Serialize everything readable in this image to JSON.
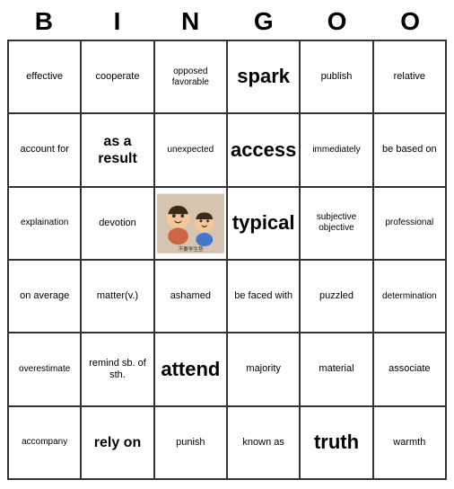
{
  "header": {
    "letters": [
      "B",
      "I",
      "N",
      "G",
      "O",
      "O"
    ]
  },
  "cells": [
    {
      "text": "effective",
      "size": "normal"
    },
    {
      "text": "cooperate",
      "size": "normal"
    },
    {
      "text": "opposed\nfavorable",
      "size": "small"
    },
    {
      "text": "spark",
      "size": "xlarge"
    },
    {
      "text": "publish",
      "size": "normal"
    },
    {
      "text": "relative",
      "size": "normal"
    },
    {
      "text": "account for",
      "size": "normal"
    },
    {
      "text": "as a result",
      "size": "large"
    },
    {
      "text": "unexpected",
      "size": "small"
    },
    {
      "text": "access",
      "size": "xlarge"
    },
    {
      "text": "immediately",
      "size": "small"
    },
    {
      "text": "be based on",
      "size": "normal"
    },
    {
      "text": "explaination",
      "size": "small"
    },
    {
      "text": "devotion",
      "size": "normal"
    },
    {
      "text": "IMAGE",
      "size": "image"
    },
    {
      "text": "typical",
      "size": "xlarge"
    },
    {
      "text": "subjective\nobjective",
      "size": "small"
    },
    {
      "text": "professional",
      "size": "small"
    },
    {
      "text": "on average",
      "size": "normal"
    },
    {
      "text": "matter(v.)",
      "size": "normal"
    },
    {
      "text": "ashamed",
      "size": "normal"
    },
    {
      "text": "be faced with",
      "size": "normal"
    },
    {
      "text": "puzzled",
      "size": "normal"
    },
    {
      "text": "determination",
      "size": "small"
    },
    {
      "text": "overestimate",
      "size": "small"
    },
    {
      "text": "remind sb. of sth.",
      "size": "normal"
    },
    {
      "text": "attend",
      "size": "xlarge"
    },
    {
      "text": "majority",
      "size": "normal"
    },
    {
      "text": "material",
      "size": "normal"
    },
    {
      "text": "associate",
      "size": "normal"
    },
    {
      "text": "accompany",
      "size": "small"
    },
    {
      "text": "rely on",
      "size": "large"
    },
    {
      "text": "punish",
      "size": "normal"
    },
    {
      "text": "known as",
      "size": "normal"
    },
    {
      "text": "truth",
      "size": "xlarge"
    },
    {
      "text": "warmth",
      "size": "normal"
    }
  ]
}
